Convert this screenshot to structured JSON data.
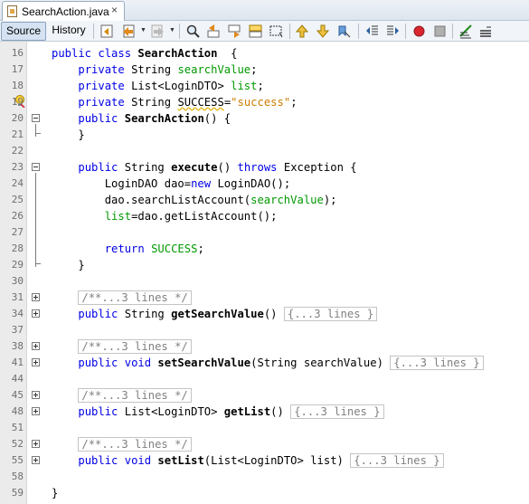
{
  "tab": {
    "title": "SearchAction.java",
    "close": "×"
  },
  "toolbar": {
    "source_label": "Source",
    "history_label": "History"
  },
  "editor": {
    "lines": [
      {
        "number": "16",
        "tokens": [
          [
            "kw",
            "public "
          ],
          [
            "kw",
            "class "
          ],
          [
            "b",
            "SearchAction"
          ],
          [
            "",
            "  {"
          ]
        ]
      },
      {
        "number": "17",
        "tokens": [
          [
            "",
            "    "
          ],
          [
            "kw",
            "private "
          ],
          [
            "",
            "String "
          ],
          [
            "fld",
            "searchValue"
          ],
          [
            "",
            ";"
          ]
        ]
      },
      {
        "number": "18",
        "tokens": [
          [
            "",
            "    "
          ],
          [
            "kw",
            "private "
          ],
          [
            "",
            "List<LoginDTO> "
          ],
          [
            "fld",
            "list"
          ],
          [
            "",
            ";"
          ]
        ]
      },
      {
        "number": "19",
        "tokens": [
          [
            "",
            "    "
          ],
          [
            "kw",
            "private "
          ],
          [
            "",
            "String "
          ],
          [
            "fldw",
            "SUCCESS"
          ],
          [
            "",
            "="
          ],
          [
            "str",
            "\"success\""
          ],
          [
            "",
            ";"
          ]
        ]
      },
      {
        "number": "20",
        "tokens": [
          [
            "",
            "    "
          ],
          [
            "kw",
            "public "
          ],
          [
            "b",
            "SearchAction"
          ],
          [
            "",
            "() {"
          ]
        ]
      },
      {
        "number": "21",
        "tokens": [
          [
            "",
            "    }"
          ]
        ]
      },
      {
        "number": "22",
        "tokens": []
      },
      {
        "number": "23",
        "tokens": [
          [
            "",
            "    "
          ],
          [
            "kw",
            "public "
          ],
          [
            "",
            "String "
          ],
          [
            "b",
            "execute"
          ],
          [
            "",
            "() "
          ],
          [
            "kw",
            "throws "
          ],
          [
            "",
            "Exception {"
          ]
        ]
      },
      {
        "number": "24",
        "tokens": [
          [
            "",
            "        LoginDAO dao="
          ],
          [
            "kw",
            "new "
          ],
          [
            "",
            "LoginDAO();"
          ]
        ]
      },
      {
        "number": "25",
        "tokens": [
          [
            "",
            "        dao.searchListAccount("
          ],
          [
            "fld",
            "searchValue"
          ],
          [
            "",
            ");"
          ]
        ]
      },
      {
        "number": "26",
        "tokens": [
          [
            "",
            "        "
          ],
          [
            "fld",
            "list"
          ],
          [
            "",
            "=dao.getListAccount();"
          ]
        ]
      },
      {
        "number": "27",
        "tokens": []
      },
      {
        "number": "28",
        "tokens": [
          [
            "",
            "        "
          ],
          [
            "kw",
            "return "
          ],
          [
            "fld",
            "SUCCESS"
          ],
          [
            "",
            ";"
          ]
        ]
      },
      {
        "number": "29",
        "tokens": [
          [
            "",
            "    }"
          ]
        ]
      },
      {
        "number": "30",
        "tokens": []
      },
      {
        "number": "31",
        "tokens": [
          [
            "",
            "    "
          ],
          [
            "col",
            "/**...3 lines */"
          ]
        ]
      },
      {
        "number": "34",
        "tokens": [
          [
            "",
            "    "
          ],
          [
            "kw",
            "public "
          ],
          [
            "",
            "String "
          ],
          [
            "b",
            "getSearchValue"
          ],
          [
            "",
            "() "
          ],
          [
            "col",
            "{...3 lines }"
          ]
        ]
      },
      {
        "number": "37",
        "tokens": []
      },
      {
        "number": "38",
        "tokens": [
          [
            "",
            "    "
          ],
          [
            "col",
            "/**...3 lines */"
          ]
        ]
      },
      {
        "number": "41",
        "tokens": [
          [
            "",
            "    "
          ],
          [
            "kw",
            "public "
          ],
          [
            "kw",
            "void "
          ],
          [
            "b",
            "setSearchValue"
          ],
          [
            "",
            "(String searchValue) "
          ],
          [
            "col",
            "{...3 lines }"
          ]
        ]
      },
      {
        "number": "44",
        "tokens": []
      },
      {
        "number": "45",
        "tokens": [
          [
            "",
            "    "
          ],
          [
            "col",
            "/**...3 lines */"
          ]
        ]
      },
      {
        "number": "48",
        "tokens": [
          [
            "",
            "    "
          ],
          [
            "kw",
            "public "
          ],
          [
            "",
            "List<LoginDTO> "
          ],
          [
            "b",
            "getList"
          ],
          [
            "",
            "() "
          ],
          [
            "col",
            "{...3 lines }"
          ]
        ]
      },
      {
        "number": "51",
        "tokens": []
      },
      {
        "number": "52",
        "tokens": [
          [
            "",
            "    "
          ],
          [
            "col",
            "/**...3 lines */"
          ]
        ]
      },
      {
        "number": "55",
        "tokens": [
          [
            "",
            "    "
          ],
          [
            "kw",
            "public "
          ],
          [
            "kw",
            "void "
          ],
          [
            "b",
            "setList"
          ],
          [
            "",
            "(List<LoginDTO> list) "
          ],
          [
            "col",
            "{...3 lines }"
          ]
        ]
      },
      {
        "number": "58",
        "tokens": []
      },
      {
        "number": "59",
        "tokens": [
          [
            "",
            "}"
          ]
        ]
      }
    ],
    "folds": [
      {
        "line": 4,
        "type": "minus",
        "end": 5
      },
      {
        "line": 7,
        "type": "minus",
        "end": 13
      },
      {
        "line": 15,
        "type": "plus"
      },
      {
        "line": 16,
        "type": "plus"
      },
      {
        "line": 18,
        "type": "plus"
      },
      {
        "line": 19,
        "type": "plus"
      },
      {
        "line": 21,
        "type": "plus"
      },
      {
        "line": 22,
        "type": "plus"
      },
      {
        "line": 24,
        "type": "plus"
      },
      {
        "line": 25,
        "type": "plus"
      }
    ],
    "class_fold": {
      "start": 0,
      "end": 27
    }
  },
  "colors": {
    "keyword": "#0000e6",
    "field": "#009900",
    "string": "#ce7b00",
    "gutter": "#ebebeb"
  },
  "icons": [
    "java-file-icon",
    "last-edit-icon",
    "back-icon",
    "forward-icon",
    "find-icon",
    "find-prev-icon",
    "find-next-icon",
    "toggle-highlight-icon",
    "toggle-rect-select-icon",
    "prev-bookmark-icon",
    "next-bookmark-icon",
    "toggle-bookmark-icon",
    "shift-left-icon",
    "shift-right-icon",
    "record-macro-icon",
    "stop-macro-icon",
    "comment-icon",
    "uncomment-icon",
    "lightbulb-icon"
  ]
}
